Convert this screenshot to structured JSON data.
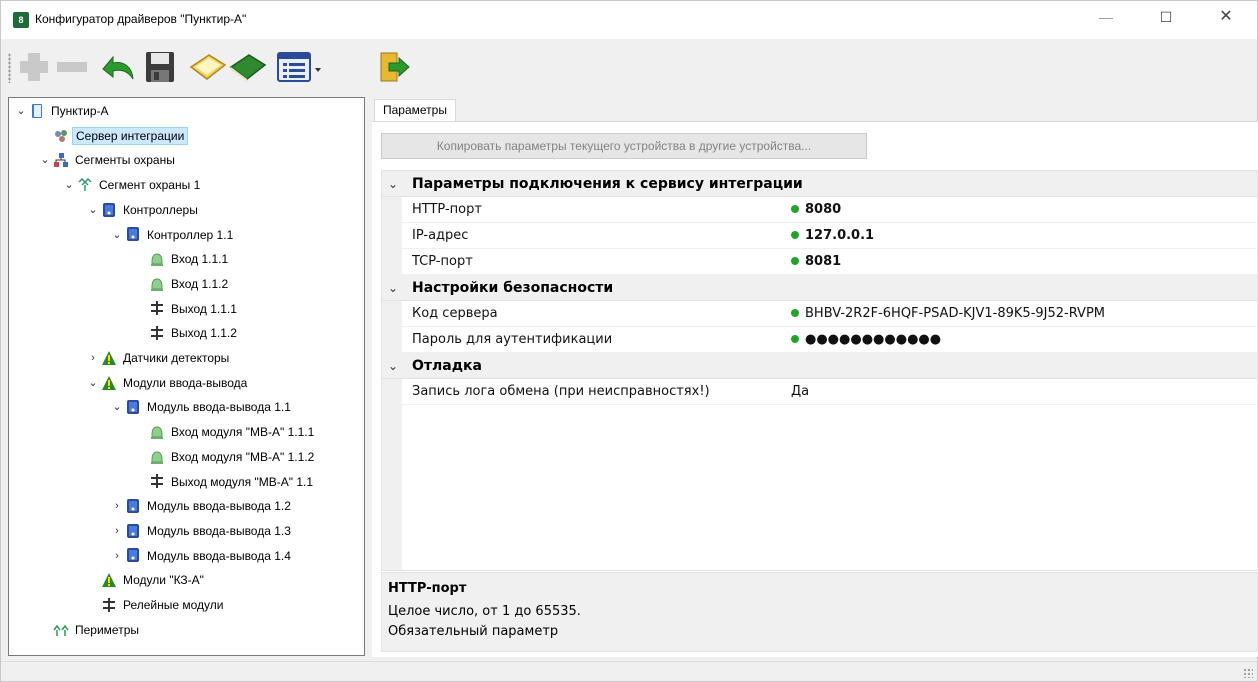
{
  "window": {
    "title": "Конфигуратор драйверов \"Пунктир-А\"",
    "app_icon_text": "8",
    "minimize": "—",
    "maximize": "☐",
    "close": "✕"
  },
  "toolbar": {
    "buttons": [
      {
        "name": "add",
        "icon": "plus-icon"
      },
      {
        "name": "remove",
        "icon": "minus-icon"
      },
      {
        "name": "undo",
        "icon": "undo-arrow-icon"
      },
      {
        "name": "save",
        "icon": "floppy-disk-icon"
      },
      {
        "name": "open-book",
        "icon": "open-book-icon"
      },
      {
        "name": "closed-book",
        "icon": "book-icon"
      },
      {
        "name": "view-menu",
        "icon": "list-window-icon"
      },
      {
        "name": "exit",
        "icon": "exit-door-icon"
      }
    ]
  },
  "tree": {
    "items": [
      {
        "label": "Пунктир-А",
        "toggle": "v",
        "icon": "book-icon"
      },
      {
        "label": "Сервер интеграции",
        "toggle": "",
        "icon": "server-icon",
        "selected": true
      },
      {
        "label": "Сегменты охраны",
        "toggle": "v",
        "icon": "network-icon"
      },
      {
        "label": "Сегмент охраны 1",
        "toggle": "v",
        "icon": "segment-icon"
      },
      {
        "label": "Контроллеры",
        "toggle": "v",
        "icon": "controller-icon"
      },
      {
        "label": "Контроллер 1.1",
        "toggle": "v",
        "icon": "controller-icon"
      },
      {
        "label": "Вход 1.1.1",
        "toggle": "",
        "icon": "bell-icon"
      },
      {
        "label": "Вход 1.1.2",
        "toggle": "",
        "icon": "bell-icon"
      },
      {
        "label": "Выход 1.1.1",
        "toggle": "",
        "icon": "relay-icon"
      },
      {
        "label": "Выход 1.1.2",
        "toggle": "",
        "icon": "relay-icon"
      },
      {
        "label": "Датчики детекторы",
        "toggle": ">",
        "icon": "warning-icon"
      },
      {
        "label": "Модули ввода-вывода",
        "toggle": "v",
        "icon": "warning-icon"
      },
      {
        "label": "Модуль ввода-вывода 1.1",
        "toggle": "v",
        "icon": "controller-icon"
      },
      {
        "label": "Вход модуля \"МВ-А\" 1.1.1",
        "toggle": "",
        "icon": "bell-icon"
      },
      {
        "label": "Вход модуля \"МВ-А\" 1.1.2",
        "toggle": "",
        "icon": "bell-icon"
      },
      {
        "label": "Выход модуля \"МВ-А\" 1.1",
        "toggle": "",
        "icon": "relay-icon"
      },
      {
        "label": "Модуль ввода-вывода 1.2",
        "toggle": ">",
        "icon": "controller-icon"
      },
      {
        "label": "Модуль ввода-вывода 1.3",
        "toggle": ">",
        "icon": "controller-icon"
      },
      {
        "label": "Модуль ввода-вывода 1.4",
        "toggle": ">",
        "icon": "controller-icon"
      },
      {
        "label": "Модули \"КЗ-А\"",
        "toggle": "",
        "icon": "warning-icon"
      },
      {
        "label": "Релейные модули",
        "toggle": "",
        "icon": "relay-icon"
      },
      {
        "label": "Периметры",
        "toggle": "",
        "icon": "perimeter-icon"
      }
    ]
  },
  "tabs": [
    {
      "label": "Параметры"
    }
  ],
  "copy_button": "Копировать параметры текущего устройства в другие устройства...",
  "grid": {
    "categories": [
      {
        "label": "Параметры подключения к сервису интеграции",
        "rows": [
          {
            "name": "HTTP-порт",
            "value": "8080",
            "bold": true,
            "dot": true
          },
          {
            "name": "IP-адрес",
            "value": "127.0.0.1",
            "bold": true,
            "dot": true
          },
          {
            "name": "TCP-порт",
            "value": "8081",
            "bold": true,
            "dot": true
          }
        ]
      },
      {
        "label": "Настройки безопасности",
        "rows": [
          {
            "name": "Код сервера",
            "value": "BHBV-2R2F-6HQF-PSAD-KJV1-89K5-9J52-RVPM",
            "bold": false,
            "dot": true
          },
          {
            "name": "Пароль для аутентификации",
            "value": "●●●●●●●●●●●●",
            "bold": false,
            "dot": true
          }
        ]
      },
      {
        "label": "Отладка",
        "rows": [
          {
            "name": "Запись лога обмена (при неисправностях!)",
            "value": "Да",
            "bold": false,
            "dot": false
          }
        ]
      }
    ]
  },
  "help": {
    "title": "HTTP-порт",
    "line1": "Целое число, от 1 до 65535.",
    "line2": "Обязательный параметр"
  },
  "colors": {
    "status_dot": "#1fa828",
    "selection": "#cce8ff"
  }
}
